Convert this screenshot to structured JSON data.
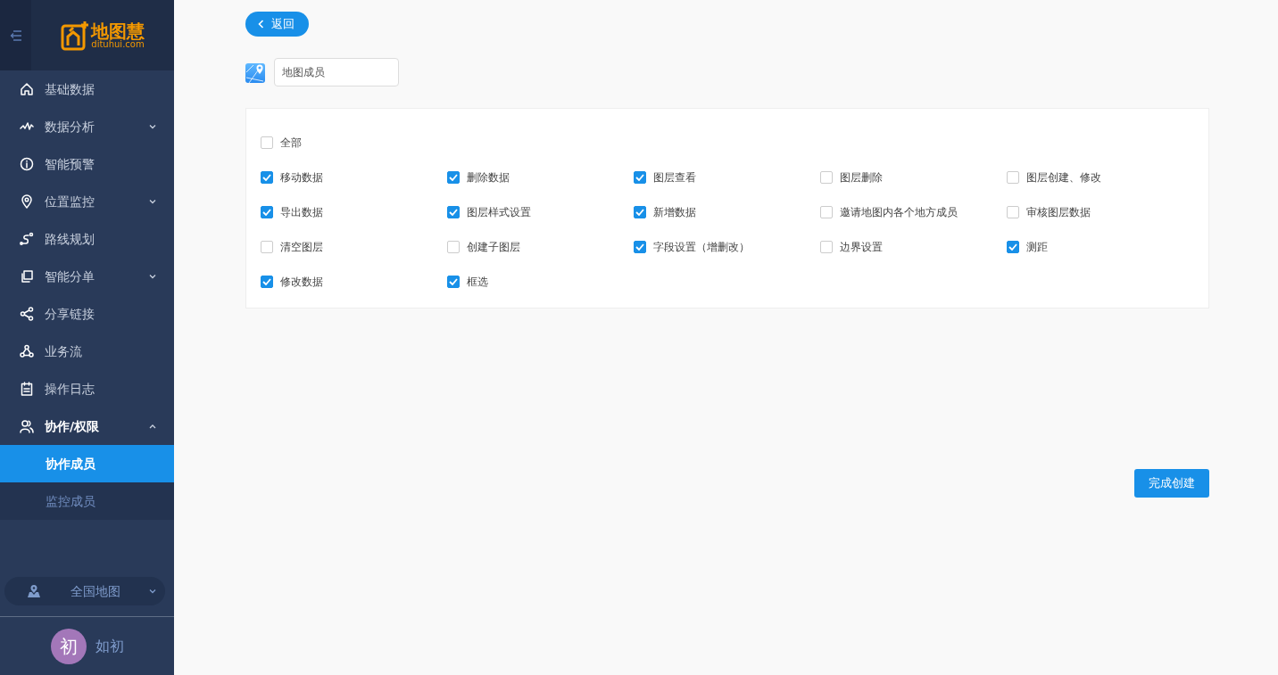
{
  "sidebar": {
    "logo": {
      "title": "地图慧",
      "domain": "dituhui.com"
    },
    "items": [
      {
        "label": "基础数据"
      },
      {
        "label": "数据分析",
        "expanded": false
      },
      {
        "label": "智能预警"
      },
      {
        "label": "位置监控",
        "expanded": false
      },
      {
        "label": "路线规划"
      },
      {
        "label": "智能分单",
        "expanded": false
      },
      {
        "label": "分享链接"
      },
      {
        "label": "业务流"
      },
      {
        "label": "操作日志"
      },
      {
        "label": "协作/权限",
        "expanded": true,
        "children": [
          {
            "label": "协作成员",
            "selected": true
          },
          {
            "label": "监控成员",
            "selected": false
          }
        ]
      }
    ],
    "map_selector": {
      "label": "全国地图"
    },
    "user": {
      "avatar": "初",
      "name": "如初"
    }
  },
  "back_button": "返回",
  "name_field": {
    "value": "地图成员"
  },
  "permissions": {
    "all": {
      "label": "全部",
      "checked": false
    },
    "items": [
      {
        "label": "移动数据",
        "checked": true
      },
      {
        "label": "删除数据",
        "checked": true
      },
      {
        "label": "图层查看",
        "checked": true
      },
      {
        "label": "图层删除",
        "checked": false
      },
      {
        "label": "图层创建、修改",
        "checked": false
      },
      {
        "label": "导出数据",
        "checked": true
      },
      {
        "label": "图层样式设置",
        "checked": true
      },
      {
        "label": "新增数据",
        "checked": true
      },
      {
        "label": "邀请地图内各个地方成员",
        "checked": false
      },
      {
        "label": "审核图层数据",
        "checked": false
      },
      {
        "label": "清空图层",
        "checked": false
      },
      {
        "label": "创建子图层",
        "checked": false
      },
      {
        "label": "字段设置（增删改）",
        "checked": true
      },
      {
        "label": "边界设置",
        "checked": false
      },
      {
        "label": "测距",
        "checked": true
      },
      {
        "label": "修改数据",
        "checked": true
      },
      {
        "label": "框选",
        "checked": true
      }
    ]
  },
  "submit_button": "完成创建"
}
